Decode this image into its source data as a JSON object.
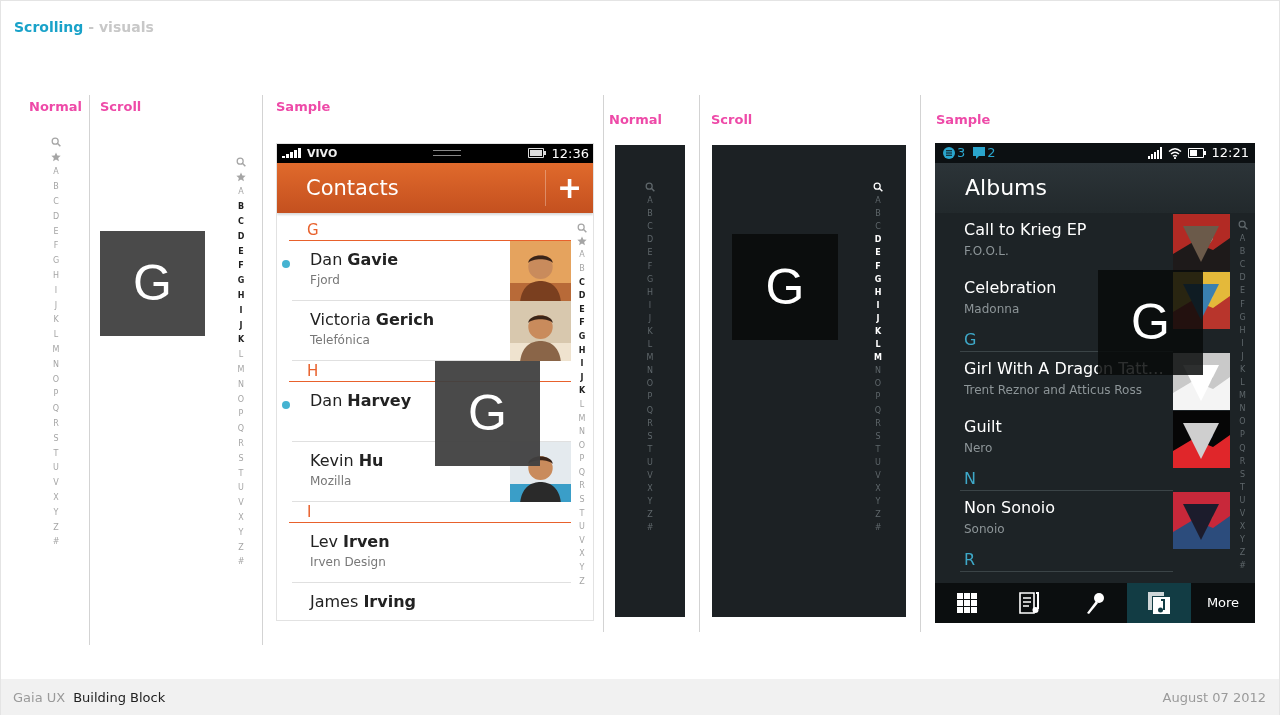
{
  "header": {
    "title": "Scrolling",
    "subtitle": "- visuals"
  },
  "panels": [
    {
      "kind": "index-light",
      "label": "Normal",
      "index": [
        {
          "kind": "search",
          "highlighted": false
        },
        {
          "kind": "star",
          "highlighted": false
        },
        {
          "kind": "letter",
          "label": "A",
          "highlighted": false
        },
        {
          "kind": "letter",
          "label": "B",
          "highlighted": false
        },
        {
          "kind": "letter",
          "label": "C",
          "highlighted": false
        },
        {
          "kind": "letter",
          "label": "D",
          "highlighted": false
        },
        {
          "kind": "letter",
          "label": "E",
          "highlighted": false
        },
        {
          "kind": "letter",
          "label": "F",
          "highlighted": false
        },
        {
          "kind": "letter",
          "label": "G",
          "highlighted": false
        },
        {
          "kind": "letter",
          "label": "H",
          "highlighted": false
        },
        {
          "kind": "letter",
          "label": "I",
          "highlighted": false
        },
        {
          "kind": "letter",
          "label": "J",
          "highlighted": false
        },
        {
          "kind": "letter",
          "label": "K",
          "highlighted": false
        },
        {
          "kind": "letter",
          "label": "L",
          "highlighted": false
        },
        {
          "kind": "letter",
          "label": "M",
          "highlighted": false
        },
        {
          "kind": "letter",
          "label": "N",
          "highlighted": false
        },
        {
          "kind": "letter",
          "label": "O",
          "highlighted": false
        },
        {
          "kind": "letter",
          "label": "P",
          "highlighted": false
        },
        {
          "kind": "letter",
          "label": "Q",
          "highlighted": false
        },
        {
          "kind": "letter",
          "label": "R",
          "highlighted": false
        },
        {
          "kind": "letter",
          "label": "S",
          "highlighted": false
        },
        {
          "kind": "letter",
          "label": "T",
          "highlighted": false
        },
        {
          "kind": "letter",
          "label": "U",
          "highlighted": false
        },
        {
          "kind": "letter",
          "label": "V",
          "highlighted": false
        },
        {
          "kind": "letter",
          "label": "X",
          "highlighted": false
        },
        {
          "kind": "letter",
          "label": "Y",
          "highlighted": false
        },
        {
          "kind": "letter",
          "label": "Z",
          "highlighted": false
        },
        {
          "kind": "letter",
          "label": "#",
          "highlighted": false
        }
      ]
    },
    {
      "kind": "scroll-light",
      "label": "Scroll",
      "overlay_letter": "G",
      "index": [
        {
          "kind": "search",
          "highlighted": false
        },
        {
          "kind": "star",
          "highlighted": false
        },
        {
          "kind": "letter",
          "label": "A",
          "highlighted": false
        },
        {
          "kind": "letter",
          "label": "B",
          "highlighted": true
        },
        {
          "kind": "letter",
          "label": "C",
          "highlighted": true
        },
        {
          "kind": "letter",
          "label": "D",
          "highlighted": true
        },
        {
          "kind": "letter",
          "label": "E",
          "highlighted": true
        },
        {
          "kind": "letter",
          "label": "F",
          "highlighted": true
        },
        {
          "kind": "letter",
          "label": "G",
          "highlighted": true
        },
        {
          "kind": "letter",
          "label": "H",
          "highlighted": true
        },
        {
          "kind": "letter",
          "label": "I",
          "highlighted": true
        },
        {
          "kind": "letter",
          "label": "J",
          "highlighted": true
        },
        {
          "kind": "letter",
          "label": "K",
          "highlighted": true
        },
        {
          "kind": "letter",
          "label": "L",
          "highlighted": false
        },
        {
          "kind": "letter",
          "label": "M",
          "highlighted": false
        },
        {
          "kind": "letter",
          "label": "N",
          "highlighted": false
        },
        {
          "kind": "letter",
          "label": "O",
          "highlighted": false
        },
        {
          "kind": "letter",
          "label": "P",
          "highlighted": false
        },
        {
          "kind": "letter",
          "label": "Q",
          "highlighted": false
        },
        {
          "kind": "letter",
          "label": "R",
          "highlighted": false
        },
        {
          "kind": "letter",
          "label": "S",
          "highlighted": false
        },
        {
          "kind": "letter",
          "label": "T",
          "highlighted": false
        },
        {
          "kind": "letter",
          "label": "U",
          "highlighted": false
        },
        {
          "kind": "letter",
          "label": "V",
          "highlighted": false
        },
        {
          "kind": "letter",
          "label": "X",
          "highlighted": false
        },
        {
          "kind": "letter",
          "label": "Y",
          "highlighted": false
        },
        {
          "kind": "letter",
          "label": "Z",
          "highlighted": false
        },
        {
          "kind": "letter",
          "label": "#",
          "highlighted": false
        }
      ]
    },
    {
      "kind": "contacts",
      "label": "Sample",
      "carrier": "VIVO",
      "time": "12:36",
      "title": "Contacts",
      "add": "+",
      "overlay_letter": "G",
      "items": [
        {
          "kind": "header",
          "label": "G"
        },
        {
          "kind": "contact",
          "name": "Dan **Gavie**",
          "company": "Fjord",
          "online": true,
          "photo": true
        },
        {
          "kind": "contact",
          "name": "Victoria **Gerich**",
          "company": "Telefónica",
          "online": false,
          "photo": true
        },
        {
          "kind": "header",
          "label": "H"
        },
        {
          "kind": "contact",
          "name": "Dan **Harvey**",
          "online": true,
          "photo": false
        },
        {
          "kind": "contact",
          "name": "Kevin **Hu**",
          "company": "Mozilla",
          "online": false,
          "photo": true
        },
        {
          "kind": "header",
          "label": "I"
        },
        {
          "kind": "contact",
          "name": "Lev **Irven**",
          "company": "Irven Design",
          "online": false,
          "photo": false
        },
        {
          "kind": "contact",
          "name": "James **Irving**",
          "online": false,
          "photo": false
        }
      ],
      "index": [
        {
          "kind": "search",
          "highlighted": false
        },
        {
          "kind": "star",
          "highlighted": false
        },
        {
          "kind": "letter",
          "label": "A",
          "highlighted": false
        },
        {
          "kind": "letter",
          "label": "B",
          "highlighted": false
        },
        {
          "kind": "letter",
          "label": "C",
          "highlighted": true
        },
        {
          "kind": "letter",
          "label": "D",
          "highlighted": true
        },
        {
          "kind": "letter",
          "label": "E",
          "highlighted": true
        },
        {
          "kind": "letter",
          "label": "F",
          "highlighted": true
        },
        {
          "kind": "letter",
          "label": "G",
          "highlighted": true
        },
        {
          "kind": "letter",
          "label": "H",
          "highlighted": true
        },
        {
          "kind": "letter",
          "label": "I",
          "highlighted": true
        },
        {
          "kind": "letter",
          "label": "J",
          "highlighted": true
        },
        {
          "kind": "letter",
          "label": "K",
          "highlighted": true
        },
        {
          "kind": "letter",
          "label": "L",
          "highlighted": false
        },
        {
          "kind": "letter",
          "label": "M",
          "highlighted": false
        },
        {
          "kind": "letter",
          "label": "N",
          "highlighted": false
        },
        {
          "kind": "letter",
          "label": "O",
          "highlighted": false
        },
        {
          "kind": "letter",
          "label": "P",
          "highlighted": false
        },
        {
          "kind": "letter",
          "label": "Q",
          "highlighted": false
        },
        {
          "kind": "letter",
          "label": "R",
          "highlighted": false
        },
        {
          "kind": "letter",
          "label": "S",
          "highlighted": false
        },
        {
          "kind": "letter",
          "label": "T",
          "highlighted": false
        },
        {
          "kind": "letter",
          "label": "U",
          "highlighted": false
        },
        {
          "kind": "letter",
          "label": "V",
          "highlighted": false
        },
        {
          "kind": "letter",
          "label": "X",
          "highlighted": false
        },
        {
          "kind": "letter",
          "label": "Y",
          "highlighted": false
        },
        {
          "kind": "letter",
          "label": "Z",
          "highlighted": false
        }
      ]
    },
    {
      "kind": "index-dark",
      "label": "Normal",
      "index": [
        {
          "kind": "search",
          "highlighted": false
        },
        {
          "kind": "letter",
          "label": "A",
          "highlighted": false
        },
        {
          "kind": "letter",
          "label": "B",
          "highlighted": false
        },
        {
          "kind": "letter",
          "label": "C",
          "highlighted": false
        },
        {
          "kind": "letter",
          "label": "D",
          "highlighted": false
        },
        {
          "kind": "letter",
          "label": "E",
          "highlighted": false
        },
        {
          "kind": "letter",
          "label": "F",
          "highlighted": false
        },
        {
          "kind": "letter",
          "label": "G",
          "highlighted": false
        },
        {
          "kind": "letter",
          "label": "H",
          "highlighted": false
        },
        {
          "kind": "letter",
          "label": "I",
          "highlighted": false
        },
        {
          "kind": "letter",
          "label": "J",
          "highlighted": false
        },
        {
          "kind": "letter",
          "label": "K",
          "highlighted": false
        },
        {
          "kind": "letter",
          "label": "L",
          "highlighted": false
        },
        {
          "kind": "letter",
          "label": "M",
          "highlighted": false
        },
        {
          "kind": "letter",
          "label": "N",
          "highlighted": false
        },
        {
          "kind": "letter",
          "label": "O",
          "highlighted": false
        },
        {
          "kind": "letter",
          "label": "P",
          "highlighted": false
        },
        {
          "kind": "letter",
          "label": "Q",
          "highlighted": false
        },
        {
          "kind": "letter",
          "label": "R",
          "highlighted": false
        },
        {
          "kind": "letter",
          "label": "S",
          "highlighted": false
        },
        {
          "kind": "letter",
          "label": "T",
          "highlighted": false
        },
        {
          "kind": "letter",
          "label": "U",
          "highlighted": false
        },
        {
          "kind": "letter",
          "label": "V",
          "highlighted": false
        },
        {
          "kind": "letter",
          "label": "X",
          "highlighted": false
        },
        {
          "kind": "letter",
          "label": "Y",
          "highlighted": false
        },
        {
          "kind": "letter",
          "label": "Z",
          "highlighted": false
        },
        {
          "kind": "letter",
          "label": "#",
          "highlighted": false
        }
      ]
    },
    {
      "kind": "scroll-dark",
      "label": "Scroll",
      "overlay_letter": "G",
      "index": [
        {
          "kind": "search",
          "highlighted": true
        },
        {
          "kind": "letter",
          "label": "A",
          "highlighted": false
        },
        {
          "kind": "letter",
          "label": "B",
          "highlighted": false
        },
        {
          "kind": "letter",
          "label": "C",
          "highlighted": false
        },
        {
          "kind": "letter",
          "label": "D",
          "highlighted": true
        },
        {
          "kind": "letter",
          "label": "E",
          "highlighted": true
        },
        {
          "kind": "letter",
          "label": "F",
          "highlighted": true
        },
        {
          "kind": "letter",
          "label": "G",
          "highlighted": true
        },
        {
          "kind": "letter",
          "label": "H",
          "highlighted": true
        },
        {
          "kind": "letter",
          "label": "I",
          "highlighted": true
        },
        {
          "kind": "letter",
          "label": "J",
          "highlighted": true
        },
        {
          "kind": "letter",
          "label": "K",
          "highlighted": true
        },
        {
          "kind": "letter",
          "label": "L",
          "highlighted": true
        },
        {
          "kind": "letter",
          "label": "M",
          "highlighted": true
        },
        {
          "kind": "letter",
          "label": "N",
          "highlighted": false
        },
        {
          "kind": "letter",
          "label": "O",
          "highlighted": false
        },
        {
          "kind": "letter",
          "label": "P",
          "highlighted": false
        },
        {
          "kind": "letter",
          "label": "Q",
          "highlighted": false
        },
        {
          "kind": "letter",
          "label": "R",
          "highlighted": false
        },
        {
          "kind": "letter",
          "label": "S",
          "highlighted": false
        },
        {
          "kind": "letter",
          "label": "T",
          "highlighted": false
        },
        {
          "kind": "letter",
          "label": "U",
          "highlighted": false
        },
        {
          "kind": "letter",
          "label": "V",
          "highlighted": false
        },
        {
          "kind": "letter",
          "label": "X",
          "highlighted": false
        },
        {
          "kind": "letter",
          "label": "Y",
          "highlighted": false
        },
        {
          "kind": "letter",
          "label": "Z",
          "highlighted": false
        },
        {
          "kind": "letter",
          "label": "#",
          "highlighted": false
        }
      ]
    },
    {
      "kind": "albums",
      "label": "Sample",
      "notifications": [
        {
          "kind": "list",
          "count": "3"
        },
        {
          "kind": "message",
          "count": "2"
        }
      ],
      "time": "12:21",
      "title": "Albums",
      "overlay_letter": "G",
      "items": [
        {
          "kind": "album",
          "title": "Call to Krieg EP",
          "artist": "F.O.O.L."
        },
        {
          "kind": "album",
          "title": "Celebration",
          "artist": "Madonna"
        },
        {
          "kind": "header",
          "label": "G"
        },
        {
          "kind": "album",
          "title": "Girl With A Dragon Tatt…",
          "artist": "Trent Reznor and Atticus Ross"
        },
        {
          "kind": "album",
          "title": "Guilt",
          "artist": "Nero"
        },
        {
          "kind": "header",
          "label": "N"
        },
        {
          "kind": "album",
          "title": "Non Sonoio",
          "artist": "Sonoio"
        },
        {
          "kind": "header",
          "label": "R"
        }
      ],
      "tabs": [
        {
          "kind": "grid",
          "selected": false
        },
        {
          "kind": "playlist",
          "selected": false
        },
        {
          "kind": "mic",
          "selected": false
        },
        {
          "kind": "albums",
          "selected": true
        },
        {
          "kind": "more",
          "label": "More",
          "selected": false
        }
      ],
      "index": [
        {
          "kind": "search",
          "highlighted": false
        },
        {
          "kind": "letter",
          "label": "A",
          "highlighted": false
        },
        {
          "kind": "letter",
          "label": "B",
          "highlighted": false
        },
        {
          "kind": "letter",
          "label": "C",
          "highlighted": false
        },
        {
          "kind": "letter",
          "label": "D",
          "highlighted": false
        },
        {
          "kind": "letter",
          "label": "E",
          "highlighted": false
        },
        {
          "kind": "letter",
          "label": "F",
          "highlighted": false
        },
        {
          "kind": "letter",
          "label": "G",
          "highlighted": false
        },
        {
          "kind": "letter",
          "label": "H",
          "highlighted": false
        },
        {
          "kind": "letter",
          "label": "I",
          "highlighted": false
        },
        {
          "kind": "letter",
          "label": "J",
          "highlighted": false
        },
        {
          "kind": "letter",
          "label": "K",
          "highlighted": false
        },
        {
          "kind": "letter",
          "label": "L",
          "highlighted": false
        },
        {
          "kind": "letter",
          "label": "M",
          "highlighted": false
        },
        {
          "kind": "letter",
          "label": "N",
          "highlighted": false
        },
        {
          "kind": "letter",
          "label": "O",
          "highlighted": false
        },
        {
          "kind": "letter",
          "label": "P",
          "highlighted": false
        },
        {
          "kind": "letter",
          "label": "Q",
          "highlighted": false
        },
        {
          "kind": "letter",
          "label": "R",
          "highlighted": false
        },
        {
          "kind": "letter",
          "label": "S",
          "highlighted": false
        },
        {
          "kind": "letter",
          "label": "T",
          "highlighted": false
        },
        {
          "kind": "letter",
          "label": "U",
          "highlighted": false
        },
        {
          "kind": "letter",
          "label": "V",
          "highlighted": false
        },
        {
          "kind": "letter",
          "label": "X",
          "highlighted": false
        },
        {
          "kind": "letter",
          "label": "Y",
          "highlighted": false
        },
        {
          "kind": "letter",
          "label": "Z",
          "highlighted": false
        },
        {
          "kind": "letter",
          "label": "#",
          "highlighted": false
        }
      ]
    }
  ],
  "footer": {
    "product": "Gaia UX",
    "section": "Building Block",
    "date": "August 07 2012"
  }
}
